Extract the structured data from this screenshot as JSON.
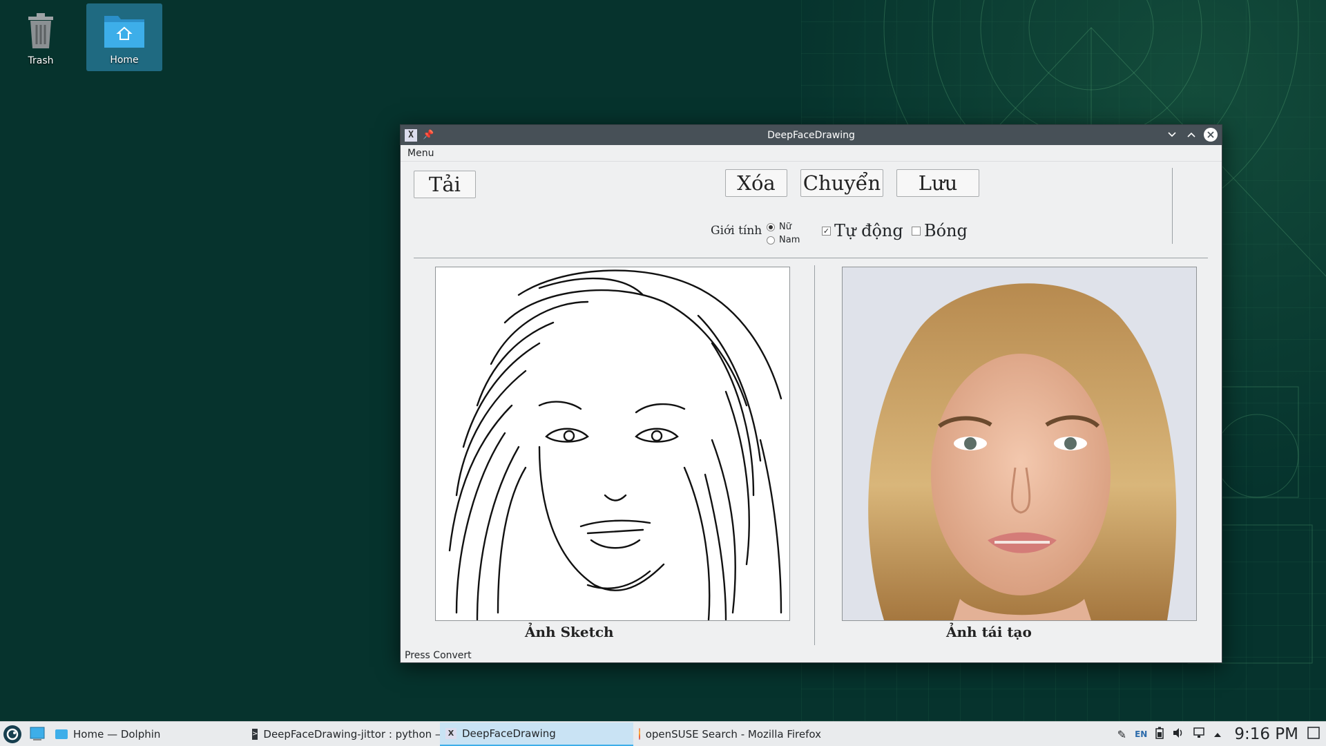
{
  "desktop": {
    "icons": [
      {
        "label": "Trash"
      },
      {
        "label": "Home"
      }
    ]
  },
  "window": {
    "title": "DeepFaceDrawing",
    "menu": "Menu",
    "buttons": {
      "load": "Tải",
      "clear": "Xóa",
      "convert": "Chuyển",
      "save": "Lưu"
    },
    "gender_label": "Giới tính",
    "gender_options": [
      "Nữ",
      "Nam"
    ],
    "gender_selected": "Nữ",
    "auto_label": "Tự động",
    "auto_checked": true,
    "shadow_label": "Bóng",
    "shadow_checked": false,
    "sketch_caption": "Ảnh Sketch",
    "result_caption": "Ảnh tái tạo",
    "status": "Press Convert"
  },
  "taskbar": {
    "tasks": [
      {
        "label": "Home — Dolphin",
        "icon": "folder-icon"
      },
      {
        "label": "DeepFaceDrawing-jittor : python —...",
        "icon": "terminal-icon"
      },
      {
        "label": "DeepFaceDrawing",
        "icon": "x-app-icon"
      },
      {
        "label": "openSUSE Search - Mozilla Firefox",
        "icon": "firefox-icon"
      }
    ],
    "tray": {
      "language": "EN",
      "clock": "9:16 PM"
    }
  }
}
